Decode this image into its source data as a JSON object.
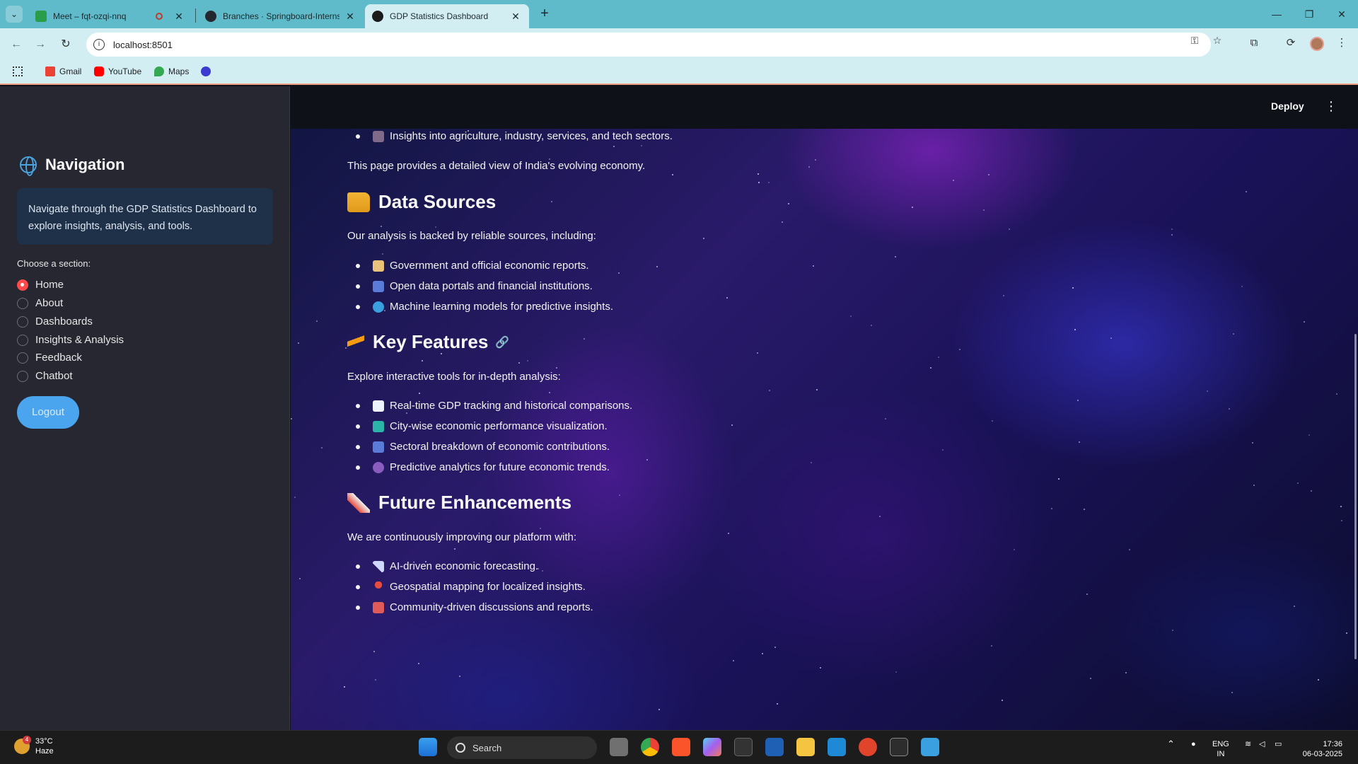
{
  "browser": {
    "tabs": [
      {
        "title": "Meet – fqt-ozqi-nnq",
        "active": false
      },
      {
        "title": "Branches · Springboard-Internship",
        "active": false
      },
      {
        "title": "GDP Statistics Dashboard",
        "active": true
      }
    ],
    "url": "localhost:8501",
    "bookmarks": [
      "Gmail",
      "YouTube",
      "Maps"
    ]
  },
  "header": {
    "deploy_label": "Deploy"
  },
  "sidebar": {
    "title": "Navigation",
    "info": "Navigate through the GDP Statistics Dashboard to explore insights, analysis, and tools.",
    "section_label": "Choose a section:",
    "options": [
      "Home",
      "About",
      "Dashboards",
      "Insights & Analysis",
      "Feedback",
      "Chatbot"
    ],
    "selected": "Home",
    "logout_label": "Logout"
  },
  "main": {
    "top_bullet": "Insights into agriculture, industry, services, and tech sectors.",
    "intro_tail": "This page provides a detailed view of India's evolving economy.",
    "data_sources": {
      "heading": "Data Sources",
      "lead": "Our analysis is backed by reliable sources, including:",
      "items": [
        "Government and official economic reports.",
        "Open data portals and financial institutions.",
        "Machine learning models for predictive insights."
      ]
    },
    "key_features": {
      "heading": "Key Features",
      "lead": "Explore interactive tools for in-depth analysis:",
      "items": [
        "Real-time GDP tracking and historical comparisons.",
        "City-wise economic performance visualization.",
        "Sectoral breakdown of economic contributions.",
        "Predictive analytics for future economic trends."
      ]
    },
    "future": {
      "heading": "Future Enhancements",
      "lead": "We are continuously improving our platform with:",
      "items": [
        "AI-driven economic forecasting.",
        "Geospatial mapping for localized insights.",
        "Community-driven discussions and reports."
      ]
    }
  },
  "taskbar": {
    "weather_temp": "33°C",
    "weather_desc": "Haze",
    "weather_badge": "4",
    "search_label": "Search",
    "lang_top": "ENG",
    "lang_bottom": "IN",
    "time": "17:36",
    "date": "06-03-2025"
  },
  "colors": {
    "accent": "#ff4b4b",
    "logout": "#4aa5ee",
    "sidebar": "#262730",
    "info_box": "#1f3148"
  }
}
